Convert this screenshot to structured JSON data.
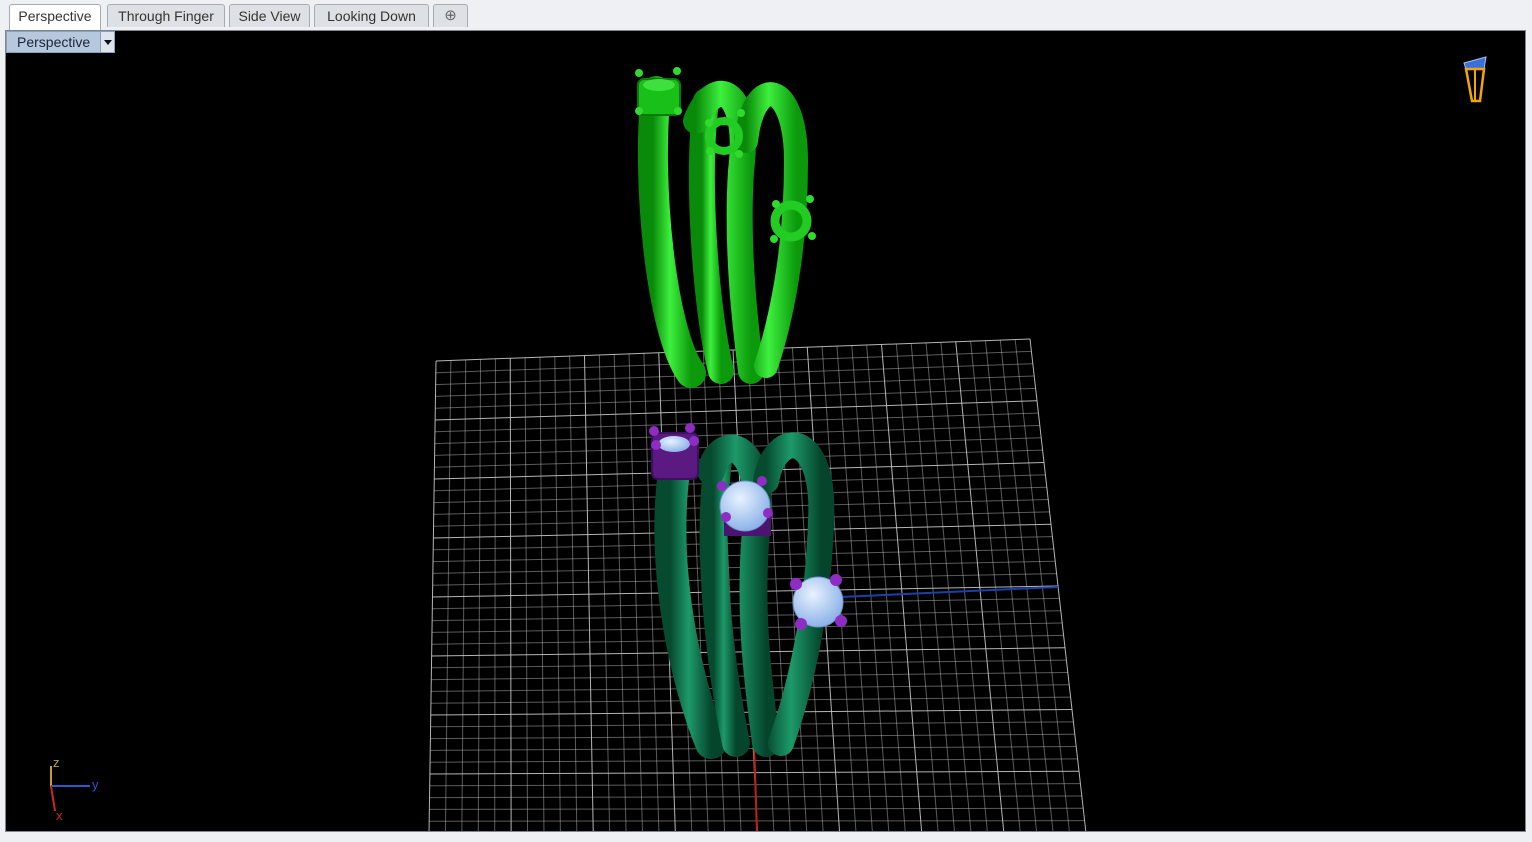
{
  "tabs": [
    {
      "label": "Perspective",
      "active": true
    },
    {
      "label": "Through Finger",
      "active": false
    },
    {
      "label": "Side View",
      "active": false
    },
    {
      "label": "Looking Down",
      "active": false
    }
  ],
  "add_tab_icon": "plus-icon",
  "viewport": {
    "label": "Perspective",
    "dropdown_icon": "dropdown-arrow-icon",
    "background": "#000000",
    "grid_color": "#c8c8c8"
  },
  "axes": {
    "z": "z",
    "y": "y",
    "x": "x",
    "x_color": "#cc2a2a",
    "y_color": "#2a5ad0",
    "z_color": "#b8a23a"
  },
  "objects": {
    "upper_ring_color": "#1ed11e",
    "lower_ring_color": "#0b6e49",
    "prong_color": "#7a1fa3",
    "gem_color": "#a9c8f2"
  },
  "camera_widget_icon": "camera-icon"
}
